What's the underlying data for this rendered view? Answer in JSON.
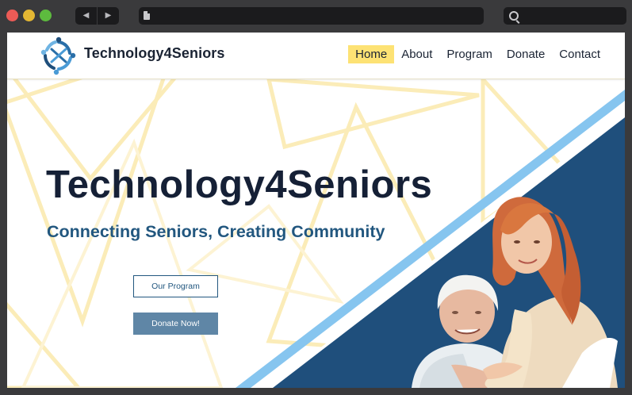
{
  "browser": {
    "back_glyph": "◀",
    "forward_glyph": "▶",
    "url": "",
    "search": ""
  },
  "site": {
    "brand": "Technology4Seniors",
    "nav": {
      "home": "Home",
      "about": "About",
      "program": "Program",
      "donate": "Donate",
      "contact": "Contact"
    },
    "active_nav": "Home"
  },
  "hero": {
    "title": "Technology4Seniors",
    "subtitle": "Connecting Seniors, Creating Community",
    "btn_program": "Our Program",
    "btn_donate": "Donate Now!"
  },
  "colors": {
    "accent_yellow": "#fde274",
    "navy": "#22577f",
    "diagonal_blue": "#1f4f7c",
    "stripe_light_blue": "#86c5ef",
    "dark_text": "#152036",
    "donate_button": "#5f86a6"
  },
  "icons": {
    "logo": "people-circle-logo",
    "page": "page-icon",
    "search": "search-icon"
  }
}
